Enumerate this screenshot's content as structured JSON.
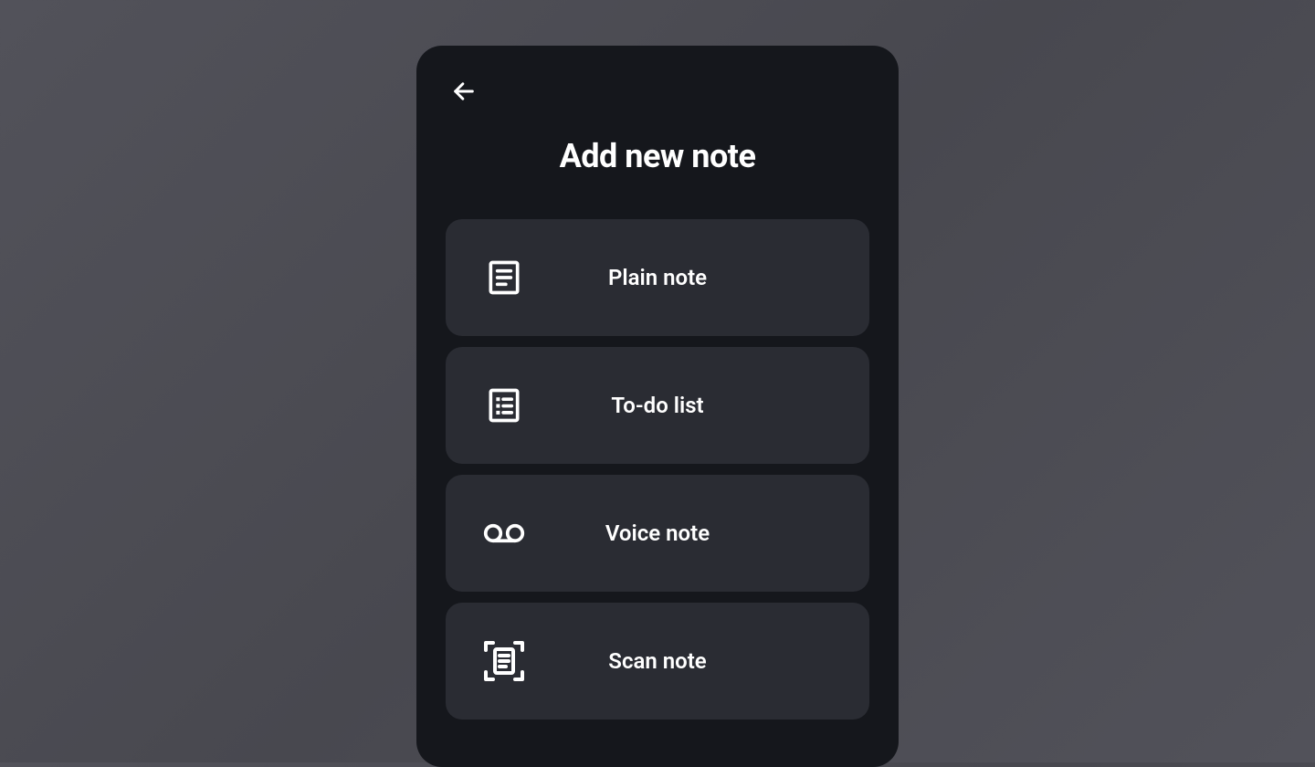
{
  "header": {
    "title": "Add new note"
  },
  "options": [
    {
      "icon": "document-icon",
      "label": "Plain note"
    },
    {
      "icon": "list-icon",
      "label": "To-do list"
    },
    {
      "icon": "voicemail-icon",
      "label": "Voice note"
    },
    {
      "icon": "scan-icon",
      "label": "Scan note"
    }
  ]
}
